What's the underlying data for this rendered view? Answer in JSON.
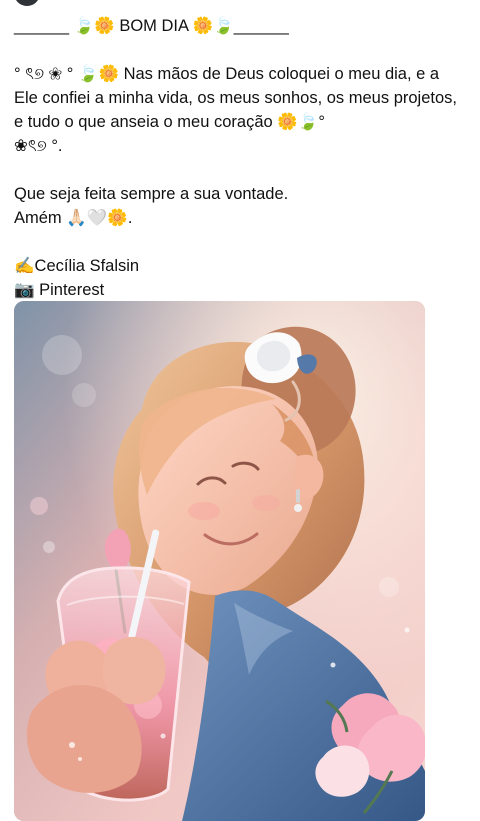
{
  "post": {
    "paragraphs": [
      "______ 🍃🌼 BOM DIA 🌼🍃______",
      "° ৎ୭ ❀ ° 🍃🌼 Nas mãos de Deus coloquei o meu dia, e a Ele confiei a minha vida, os meus sonhos, os meus projetos, e tudo o que anseia o meu coração 🌼🍃°\n❀ৎ୭ °.",
      "Que seja feita sempre a sua vontade.\nAmém 🙏🏻🤍🌼.",
      "✍️Cecília Sfalsin\n📷 Pinterest"
    ]
  },
  "image": {
    "icon": "photo-illustration",
    "colors": {
      "background": "#f2c7c3",
      "hair": "#d59a72",
      "skin": "#f4c0a7",
      "shirt": "#4f6f9f",
      "flower": "#f7a6b9"
    }
  }
}
